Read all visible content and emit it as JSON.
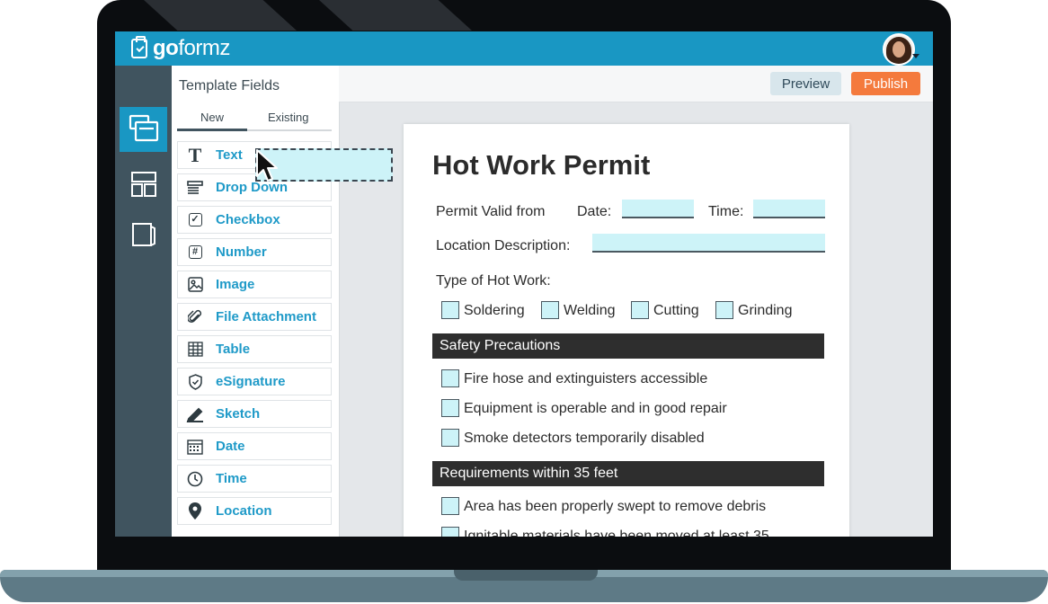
{
  "app": {
    "logo_bold": "go",
    "logo_thin": "formz"
  },
  "sidebar": {
    "title": "Template Fields",
    "tabs": [
      {
        "label": "New",
        "active": true
      },
      {
        "label": "Existing",
        "active": false
      }
    ],
    "items": [
      {
        "label": "Text",
        "icon": "text-icon"
      },
      {
        "label": "Drop Down",
        "icon": "dropdown-icon"
      },
      {
        "label": "Checkbox",
        "icon": "checkbox-icon"
      },
      {
        "label": "Number",
        "icon": "number-icon"
      },
      {
        "label": "Image",
        "icon": "image-icon"
      },
      {
        "label": "File Attachment",
        "icon": "paperclip-icon"
      },
      {
        "label": "Table",
        "icon": "table-icon"
      },
      {
        "label": "eSignature",
        "icon": "shield-check-icon"
      },
      {
        "label": "Sketch",
        "icon": "pencil-icon"
      },
      {
        "label": "Date",
        "icon": "calendar-icon"
      },
      {
        "label": "Time",
        "icon": "clock-icon"
      },
      {
        "label": "Location",
        "icon": "location-pin-icon"
      }
    ]
  },
  "toolbar": {
    "preview_label": "Preview",
    "publish_label": "Publish"
  },
  "form": {
    "title": "Hot Work Permit",
    "permit_valid_from": "Permit Valid from",
    "date_label": "Date:",
    "time_label": "Time:",
    "location_label": "Location Description:",
    "type_label": "Type of Hot Work:",
    "work_types": [
      "Soldering",
      "Welding",
      "Cutting",
      "Grinding"
    ],
    "section_safety": "Safety Precautions",
    "safety_items": [
      "Fire hose and extinguisters accessible",
      "Equipment is operable and in good repair",
      "Smoke detectors temporarily disabled"
    ],
    "section_requirements": "Requirements within 35 feet",
    "requirement_items": [
      "Area has been properly swept to remove debris",
      "Ignitable materials have been moved at least 35"
    ]
  },
  "colors": {
    "brand": "#1997c3",
    "nav": "#40545f",
    "publish": "#f47a3d",
    "field_fill": "#cdf3f8",
    "label": "#1f9ac8"
  }
}
